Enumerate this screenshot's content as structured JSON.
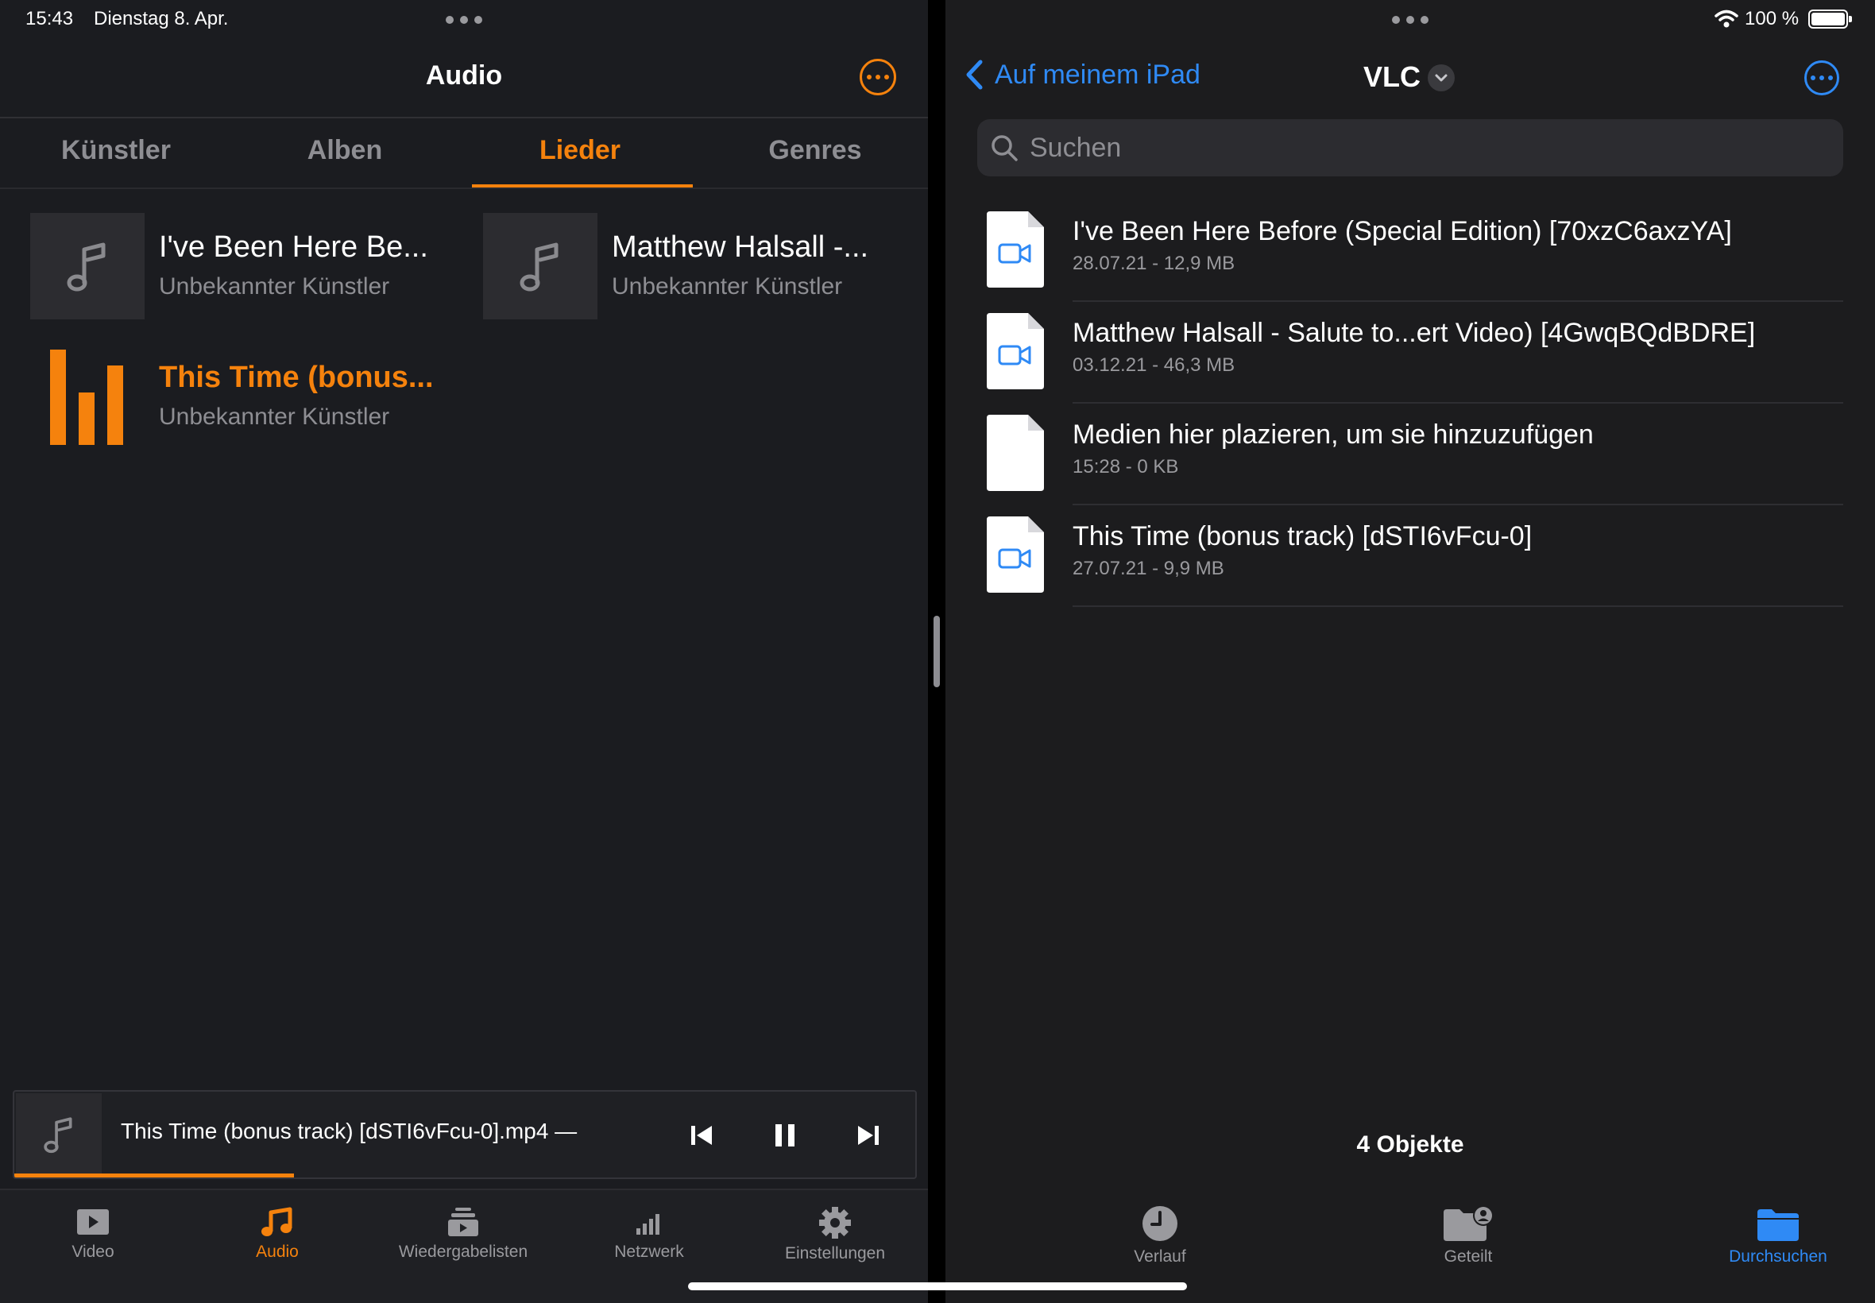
{
  "status": {
    "time": "15:43",
    "date": "Dienstag 8. Apr.",
    "battery": "100 %"
  },
  "left": {
    "title": "Audio",
    "tabs": [
      {
        "label": "Künstler",
        "active": false
      },
      {
        "label": "Alben",
        "active": false
      },
      {
        "label": "Lieder",
        "active": true
      },
      {
        "label": "Genres",
        "active": false
      }
    ],
    "songs": [
      {
        "title": "I've Been Here Be...",
        "artist": "Unbekannter Künstler",
        "icon": "music-note-icon"
      },
      {
        "title": "Matthew Halsall -...",
        "artist": "Unbekannter Künstler",
        "icon": "music-note-icon"
      },
      {
        "title": "This Time (bonus...",
        "artist": "Unbekannter Künstler",
        "icon": "equalizer-bars-icon",
        "playing": true
      }
    ],
    "mini_player": {
      "title": "This Time (bonus track) [dSTI6vFcu-0].mp4 —",
      "progress": 0.31
    },
    "tabbar": [
      {
        "label": "Video",
        "icon": "video-play-icon",
        "active": false
      },
      {
        "label": "Audio",
        "icon": "music-note-icon",
        "active": true
      },
      {
        "label": "Wiedergabelisten",
        "icon": "playlists-icon",
        "active": false
      },
      {
        "label": "Netzwerk",
        "icon": "network-bars-icon",
        "active": false
      },
      {
        "label": "Einstellungen",
        "icon": "gear-icon",
        "active": false
      }
    ]
  },
  "right": {
    "back_label": "Auf meinem iPad",
    "title": "VLC",
    "search_placeholder": "Suchen",
    "files": [
      {
        "name": "I've Been Here Before (Special Edition) [70xzC6axzYA]",
        "meta": "28.07.21 - 12,9 MB",
        "icon": "video-file-icon"
      },
      {
        "name": "Matthew Halsall - Salute to...ert Video) [4GwqBQdBDRE]",
        "meta": "03.12.21 - 46,3 MB",
        "icon": "video-file-icon"
      },
      {
        "name": "Medien hier plazieren, um sie hinzuzufügen",
        "meta": "15:28 - 0 KB",
        "icon": "blank-file-icon"
      },
      {
        "name": "This Time (bonus track) [dSTI6vFcu-0]",
        "meta": "27.07.21 - 9,9 MB",
        "icon": "video-file-icon"
      }
    ],
    "count": "4 Objekte",
    "tabbar": [
      {
        "label": "Verlauf",
        "icon": "clock-icon",
        "active": false
      },
      {
        "label": "Geteilt",
        "icon": "shared-folder-icon",
        "active": false
      },
      {
        "label": "Durchsuchen",
        "icon": "folder-icon",
        "active": true
      }
    ]
  },
  "colors": {
    "accent_orange": "#f5820d",
    "accent_blue": "#2f8af5",
    "background": "#1b1c20"
  }
}
